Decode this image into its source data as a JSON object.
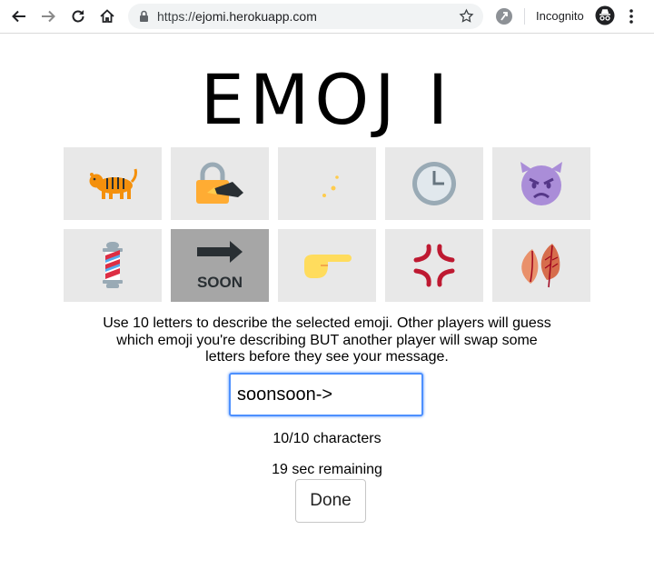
{
  "browser": {
    "url_scheme": "https://",
    "url_host": "ejomi.herokuapp.com",
    "incognito_label": "Incognito",
    "icons": [
      "back-arrow-icon",
      "forward-arrow-icon",
      "reload-icon",
      "home-icon",
      "lock-icon",
      "star-icon",
      "extension-icon",
      "incognito-icon",
      "kebab-menu-icon"
    ]
  },
  "page": {
    "logo": "EMOJ I",
    "emoji_grid": [
      {
        "name": "tiger",
        "selected": false
      },
      {
        "name": "locked-with-pen",
        "selected": false
      },
      {
        "name": "crescent-moon",
        "selected": false
      },
      {
        "name": "three-oclock",
        "selected": false
      },
      {
        "name": "angry-devil",
        "selected": false
      },
      {
        "name": "barber-pole",
        "selected": false
      },
      {
        "name": "soon-arrow",
        "selected": true
      },
      {
        "name": "pointing-right",
        "selected": false
      },
      {
        "name": "anger-symbol",
        "selected": false
      },
      {
        "name": "fallen-leaves",
        "selected": false
      }
    ],
    "soon_label": "SOON",
    "instructions_line1": "Use 10 letters to describe the selected emoji. Other players will guess",
    "instructions_line2": "which emoji you're describing BUT another player will swap some",
    "instructions_line3": "letters before they see your message.",
    "message_value": "soonsoon->",
    "char_count": "10/10 characters",
    "timer": "19 sec remaining",
    "done_label": "Done"
  },
  "colors": {
    "tile_bg": "#e8e8e8",
    "tile_selected_bg": "#a6a6a6",
    "input_focus": "#4d90fe"
  }
}
